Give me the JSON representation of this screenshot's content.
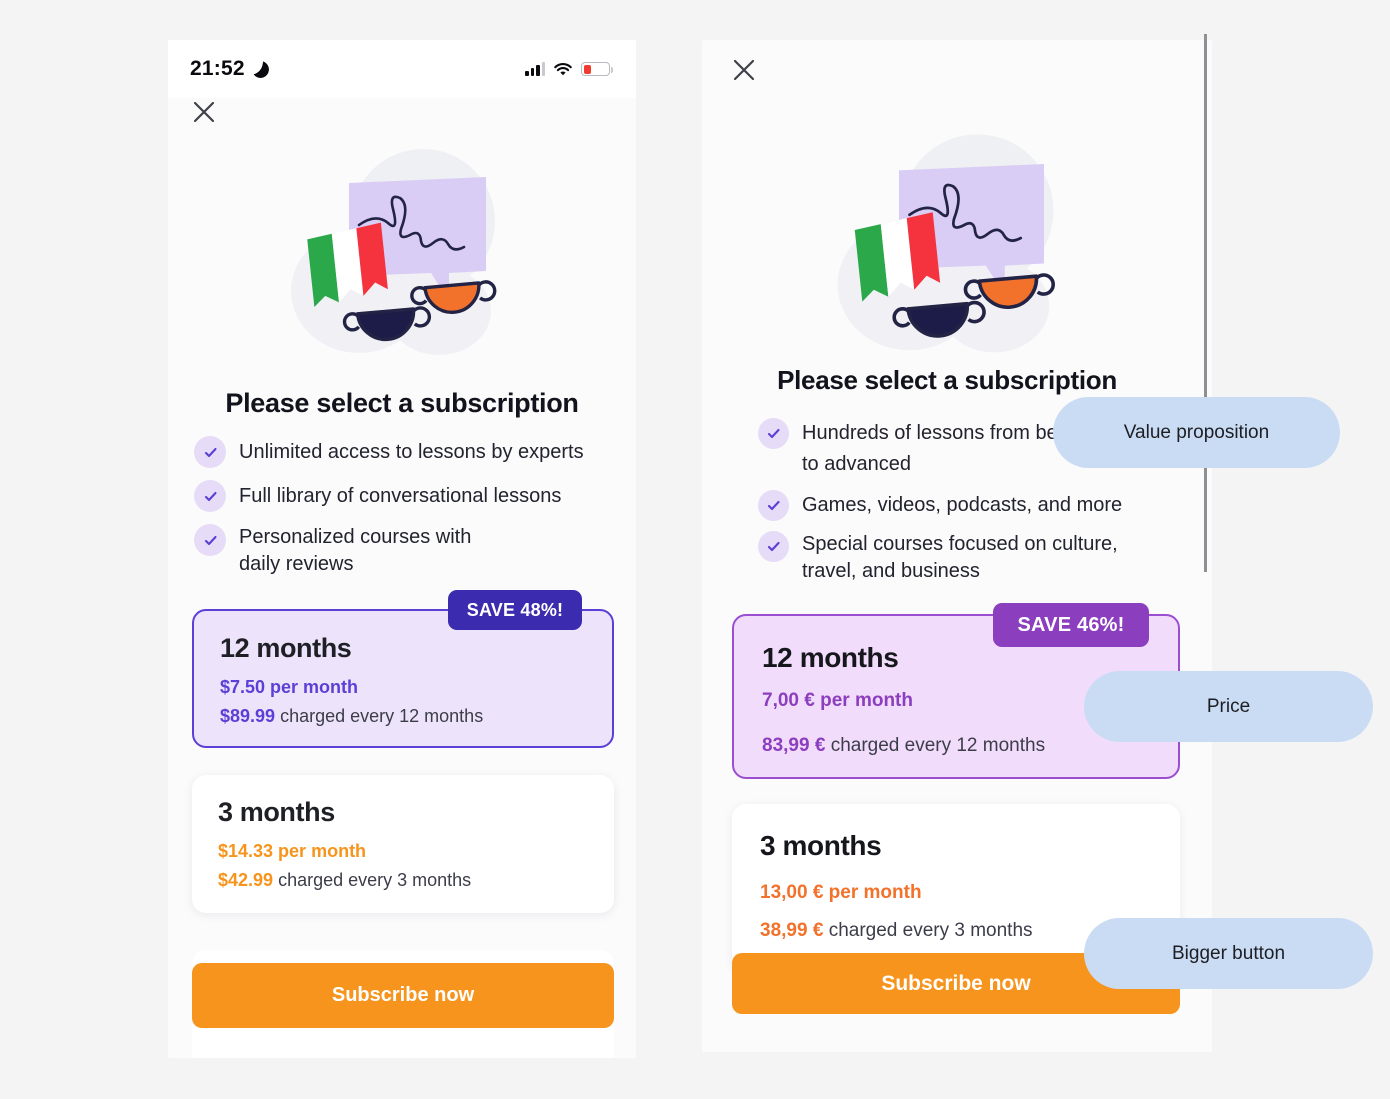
{
  "page": {
    "background": "#f4f4f5",
    "accent_orange": "#F7941D"
  },
  "left_phone": {
    "status_bar": {
      "time": "21:52",
      "moon_icon": "moon-icon",
      "signal_icon": "signal-bars-icon",
      "wifi_icon": "wifi-icon",
      "battery_icon": "battery-low-icon",
      "battery_color": "#f23a2e"
    },
    "close_label": "×",
    "illustration": "italian-language-illustration",
    "headline": "Please select a subscription",
    "bullets": [
      "Unlimited access to lessons by experts",
      "Full library of conversational lessons",
      "Personalized courses with\ndaily reviews"
    ],
    "plans": [
      {
        "badge": "SAVE 48%!",
        "badge_color": "#3B2BAE",
        "title": "12 months",
        "per_month": "$7.50 per month",
        "charged_amount": "$89.99",
        "charged_rest": "charged every 12 months",
        "accent": "#5B3FD6",
        "selected": true
      },
      {
        "title": "3 months",
        "per_month": "$14.33 per month",
        "charged_amount": "$42.99",
        "charged_rest": "charged every 3 months",
        "accent": "#F7941D",
        "selected": false
      }
    ],
    "subscribe_label": "Subscribe now"
  },
  "right_phone": {
    "close_label": "×",
    "illustration": "italian-language-illustration",
    "headline": "Please select a subscription",
    "bullets": [
      "Hundreds of lessons from beginner\nto advanced",
      "Games, videos, podcasts, and more",
      "Special courses focused on culture,\ntravel, and business"
    ],
    "plans": [
      {
        "badge": "SAVE 46%!",
        "badge_color": "#8B3FBF",
        "title": "12 months",
        "per_month": "7,00 € per month",
        "charged_amount": "83,99 €",
        "charged_rest": "charged every 12 months",
        "accent": "#8B3FBF",
        "selected": true
      },
      {
        "title": "3 months",
        "per_month": "13,00 € per month",
        "charged_amount": "38,99 €",
        "charged_rest": "charged every 3 months",
        "accent": "#F7941D",
        "selected": false
      }
    ],
    "subscribe_label": "Subscribe now"
  },
  "annotations": [
    {
      "label": "Value proposition",
      "color": "#cadcf3"
    },
    {
      "label": "Price",
      "color": "#cadcf3"
    },
    {
      "label": "Bigger button",
      "color": "#cadcf3"
    }
  ]
}
